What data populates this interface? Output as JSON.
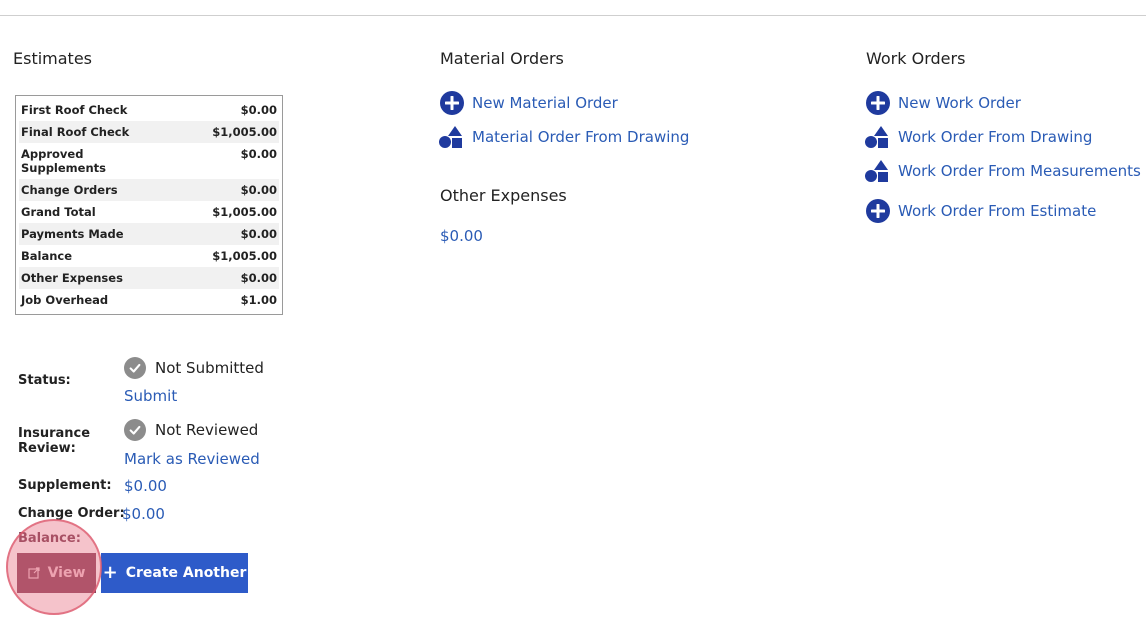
{
  "estimates": {
    "title": "Estimates",
    "summary": [
      {
        "label": "First Roof Check",
        "value": "$0.00"
      },
      {
        "label": "Final Roof Check",
        "value": "$1,005.00"
      },
      {
        "label": "Approved Supplements",
        "value": "$0.00"
      },
      {
        "label": "Change Orders",
        "value": "$0.00"
      },
      {
        "label": "Grand Total",
        "value": "$1,005.00"
      },
      {
        "label": "Payments Made",
        "value": "$0.00"
      },
      {
        "label": "Balance",
        "value": "$1,005.00"
      },
      {
        "label": "Other Expenses",
        "value": "$0.00"
      },
      {
        "label": "Job Overhead",
        "value": "$1.00"
      }
    ],
    "status_label": "Status:",
    "status_value": "Not Submitted",
    "submit_link": "Submit",
    "insurance_label": "Insurance Review:",
    "insurance_value": "Not Reviewed",
    "mark_reviewed_link": "Mark as Reviewed",
    "supplement_label": "Supplement:",
    "supplement_value": "$0.00",
    "change_order_label": "Change Order:",
    "change_order_value": "$0.00",
    "balance_label": "Balance:",
    "view_button": "View",
    "create_button": "Create Another"
  },
  "material_orders": {
    "title": "Material Orders",
    "new_link": "New Material Order",
    "from_drawing_link": "Material Order From Drawing"
  },
  "other_expenses": {
    "title": "Other Expenses",
    "value": "$0.00"
  },
  "work_orders": {
    "title": "Work Orders",
    "new_link": "New Work Order",
    "from_drawing_link": "Work Order From Drawing",
    "from_measurements_link": "Work Order From Measurements",
    "from_estimate_link": "Work Order From Estimate"
  },
  "colors": {
    "link": "#2a5bb5",
    "icon": "#1f3a9e",
    "primary_button": "#2e5bc9",
    "highlight": "#e87082"
  }
}
